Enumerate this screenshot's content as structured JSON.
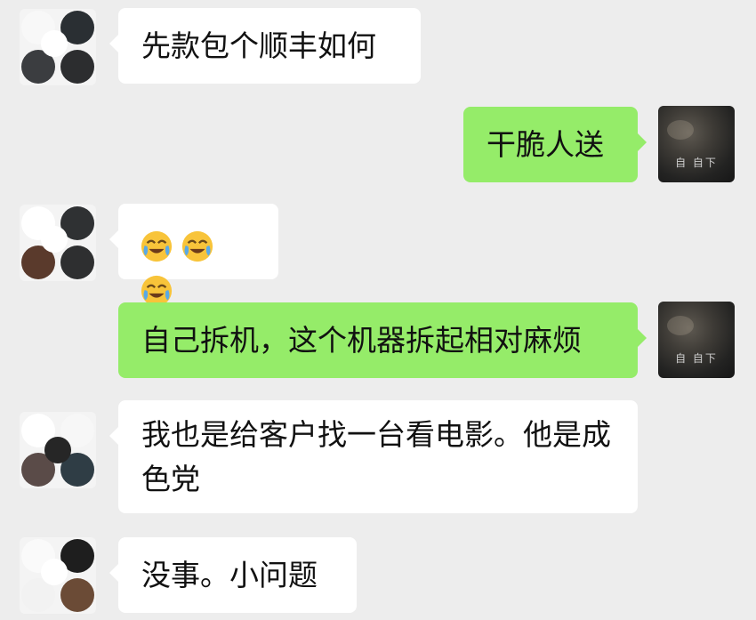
{
  "messages": [
    {
      "side": "in",
      "text": "先款包个顺丰如何"
    },
    {
      "side": "out",
      "text": "干脆人送"
    },
    {
      "side": "in",
      "emoji": [
        "crying-laughing-emoji",
        "crying-laughing-emoji",
        "crying-laughing-emoji"
      ]
    },
    {
      "side": "out",
      "text": "自己拆机，这个机器拆起相对麻烦"
    },
    {
      "side": "in",
      "text": "我也是给客户找一台看电影。他是成色党"
    },
    {
      "side": "in",
      "text": "没事。小问题"
    }
  ],
  "own_avatar": {
    "caption": "自 自下"
  },
  "colors": {
    "background": "#ededed",
    "incoming_bubble": "#ffffff",
    "outgoing_bubble": "#95ec69"
  }
}
